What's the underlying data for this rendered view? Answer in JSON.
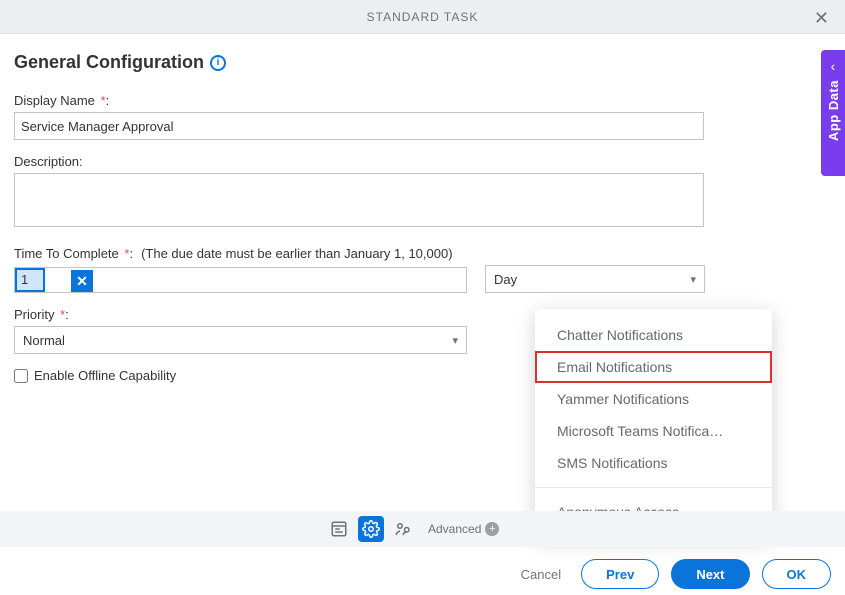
{
  "header": {
    "title": "STANDARD TASK"
  },
  "section": {
    "heading": "General Configuration"
  },
  "fields": {
    "displayName": {
      "label": "Display Name",
      "value": "Service Manager Approval"
    },
    "description": {
      "label": "Description:",
      "value": ""
    },
    "ttc": {
      "label": "Time To Complete",
      "hint": "(The due date must be earlier than January 1, 10,000)",
      "value": "1",
      "unit": "Day"
    },
    "priority": {
      "label": "Priority",
      "value": "Normal"
    },
    "offline": {
      "label": "Enable Offline Capability"
    }
  },
  "popup": {
    "items": [
      "Chatter Notifications",
      "Email Notifications",
      "Yammer Notifications",
      "Microsoft Teams Notifica…",
      "SMS Notifications"
    ],
    "secondary": [
      "Anonymous Access"
    ]
  },
  "toolbar": {
    "advanced": "Advanced"
  },
  "footer": {
    "cancel": "Cancel",
    "prev": "Prev",
    "next": "Next",
    "ok": "OK"
  },
  "sideTab": {
    "label": "App Data"
  }
}
